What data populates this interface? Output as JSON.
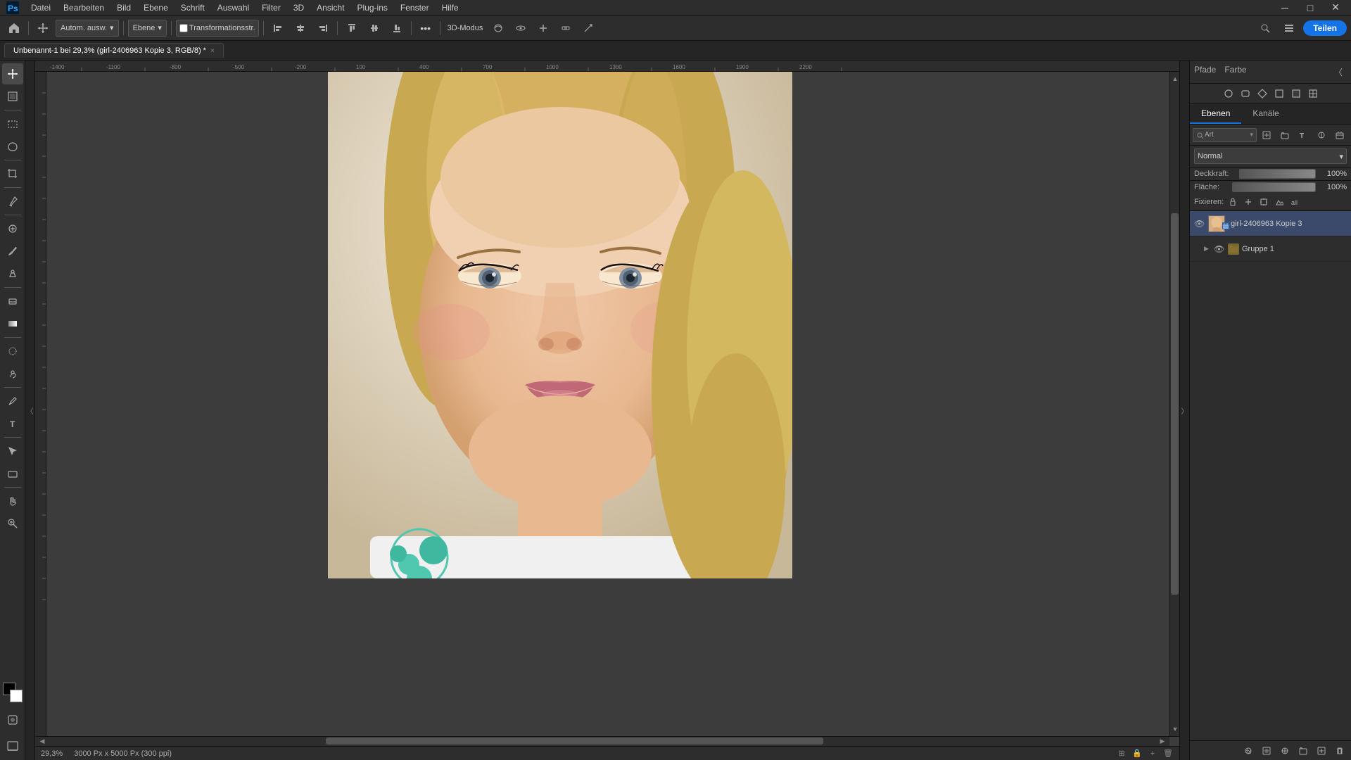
{
  "app": {
    "title": "Adobe Photoshop"
  },
  "menubar": {
    "items": [
      "Datei",
      "Bearbeiten",
      "Bild",
      "Ebene",
      "Schrift",
      "Auswahl",
      "Filter",
      "3D",
      "Ansicht",
      "Plug-ins",
      "Fenster",
      "Hilfe"
    ]
  },
  "toolbar": {
    "auto_label": "Autom. ausw.",
    "ebene_label": "Ebene",
    "transformations_label": "Transformationsstr.",
    "share_label": "Teilen",
    "mode_3d_label": "3D-Modus"
  },
  "tab": {
    "title": "Unbenannt-1 bei 29,3% (girl-2406963 Kopie 3, RGB/8) *",
    "close": "×"
  },
  "status": {
    "zoom": "29,3%",
    "dimensions": "3000 Px x 5000 Px (300 ppi)"
  },
  "right_panel": {
    "tabs": {
      "paths": "Pfade",
      "color": "Farbe"
    },
    "layers_tab": "Ebenen",
    "channels_tab": "Kanäle",
    "blend_mode": "Normal",
    "opacity_label": "Deckkraft:",
    "opacity_value": "100%",
    "fill_label": "Fläche:",
    "fill_value": "100%",
    "fix_label": "Fixieren:",
    "layers": [
      {
        "name": "girl-2406963 Kopie 3",
        "type": "smart",
        "visible": true,
        "active": true
      },
      {
        "name": "Gruppe 1",
        "type": "group",
        "visible": true,
        "active": false,
        "collapsed": true
      }
    ]
  },
  "tools": {
    "items": [
      {
        "name": "move",
        "icon": "✛",
        "active": true
      },
      {
        "name": "artboard",
        "icon": "⬜"
      },
      {
        "name": "lasso",
        "icon": "⭕"
      },
      {
        "name": "crop",
        "icon": "⊡"
      },
      {
        "name": "eyedropper",
        "icon": "🖊"
      },
      {
        "name": "healing",
        "icon": "🔧"
      },
      {
        "name": "brush",
        "icon": "🖌"
      },
      {
        "name": "clone",
        "icon": "✂"
      },
      {
        "name": "eraser",
        "icon": "⊘"
      },
      {
        "name": "gradient",
        "icon": "◧"
      },
      {
        "name": "blur",
        "icon": "◉"
      },
      {
        "name": "dodge",
        "icon": "◑"
      },
      {
        "name": "pen",
        "icon": "🖊"
      },
      {
        "name": "type",
        "icon": "T"
      },
      {
        "name": "path-select",
        "icon": "↖"
      },
      {
        "name": "shape",
        "icon": "▭"
      },
      {
        "name": "hand",
        "icon": "✋"
      },
      {
        "name": "zoom",
        "icon": "🔍"
      }
    ]
  }
}
